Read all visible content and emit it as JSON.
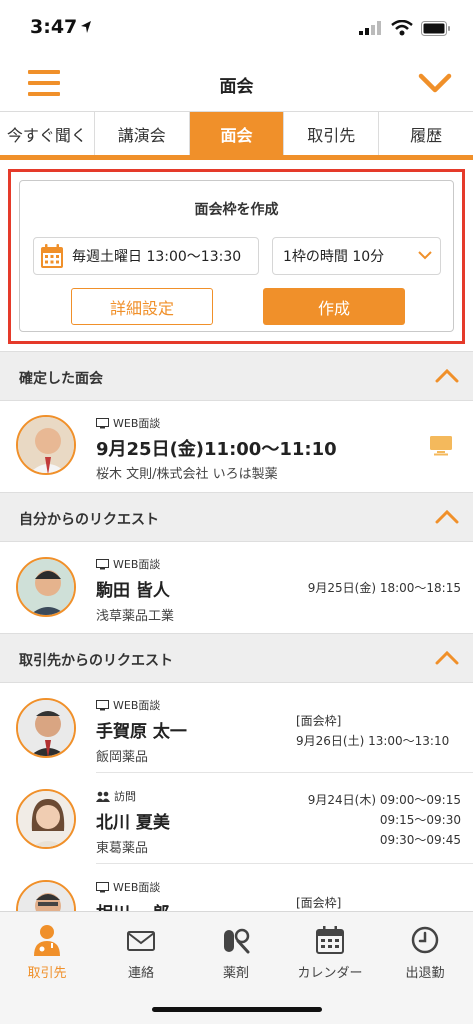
{
  "status": {
    "time": "3:47"
  },
  "header": {
    "title": "面会"
  },
  "tabs": [
    {
      "label": "今すぐ聞く"
    },
    {
      "label": "講演会"
    },
    {
      "label": "面会"
    },
    {
      "label": "取引先"
    },
    {
      "label": "履歴"
    }
  ],
  "create_slot": {
    "title": "面会枠を作成",
    "schedule": "毎週土曜日 13:00〜13:30",
    "duration": "1枠の時間 10分",
    "detail_button": "詳細設定",
    "create_button": "作成"
  },
  "sections": {
    "confirmed": {
      "label": "確定した面会",
      "items": [
        {
          "type": "WEB面談",
          "datetime": "9月25日(金)11:00〜11:10",
          "person": "桜木 文則/株式会社 いろは製薬"
        }
      ]
    },
    "my_requests": {
      "label": "自分からのリクエスト",
      "items": [
        {
          "type": "WEB面談",
          "name": "駒田 皆人",
          "company": "浅草薬品工業",
          "time": "9月25日(金) 18:00〜18:15"
        }
      ]
    },
    "client_requests": {
      "label": "取引先からのリクエスト",
      "items": [
        {
          "type": "WEB面談",
          "name": "手賀原 太一",
          "company": "飯岡薬品",
          "tag": "[面会枠]",
          "time": "9月26日(土) 13:00〜13:10"
        },
        {
          "type": "訪問",
          "name": "北川 夏美",
          "company": "東葛薬品",
          "times": [
            "9月24日(木) 09:00〜09:15",
            "09:15〜09:30",
            "09:30〜09:45"
          ]
        },
        {
          "type": "WEB面談",
          "name": "相川 一郎",
          "tag": "[面会枠]"
        }
      ]
    }
  },
  "tabbar": [
    {
      "label": "取引先",
      "icon": "doctor-icon",
      "active": true
    },
    {
      "label": "連絡",
      "icon": "mail-icon"
    },
    {
      "label": "薬剤",
      "icon": "pills-icon"
    },
    {
      "label": "カレンダー",
      "icon": "calendar-icon"
    },
    {
      "label": "出退勤",
      "icon": "clock-icon"
    }
  ],
  "colors": {
    "accent": "#f0902a",
    "highlight": "#e53a2a"
  }
}
